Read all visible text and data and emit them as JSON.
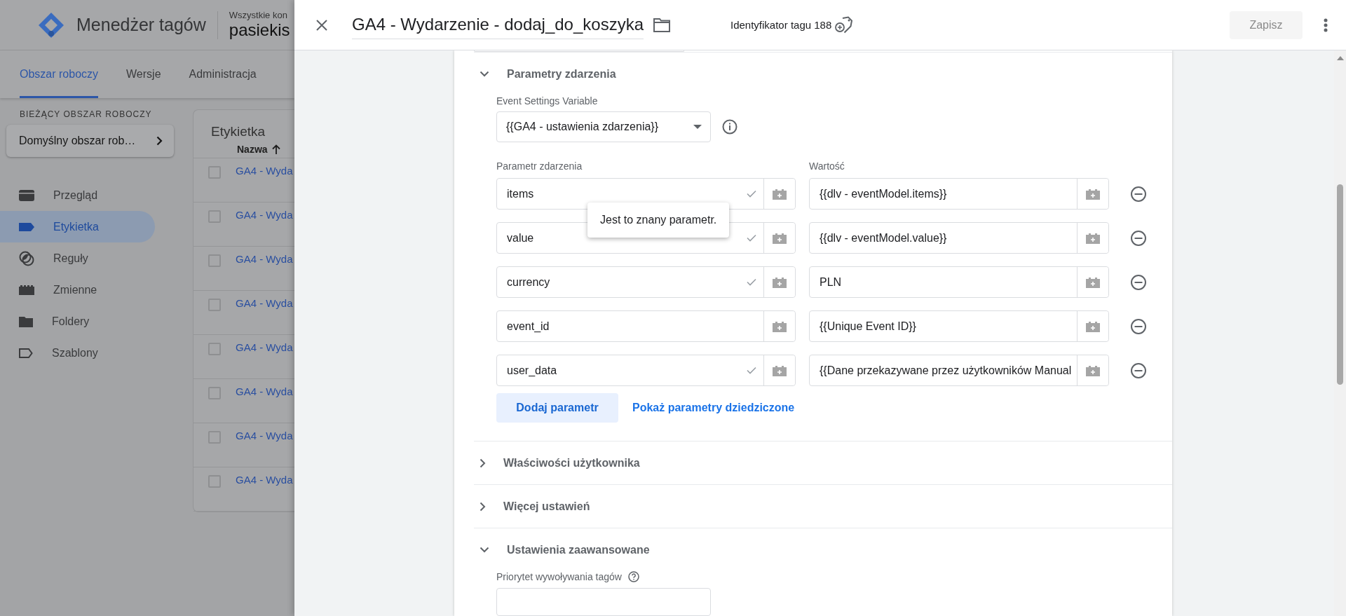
{
  "app": {
    "product": "Menedżer tagów",
    "account_label": "Wszystkie kon",
    "container": "pasiekis",
    "tabs": [
      {
        "label": "Obszar roboczy",
        "selected": true
      },
      {
        "label": "Wersje",
        "selected": false
      },
      {
        "label": "Administracja",
        "selected": false
      }
    ],
    "workspace": {
      "heading": "BIEŻĄCY OBSZAR ROBOCZY",
      "name": "Domyślny obszar rob…"
    },
    "nav": [
      {
        "kind": "overview",
        "label": "Przegląd",
        "selected": false
      },
      {
        "kind": "tags",
        "label": "Etykietka",
        "selected": true
      },
      {
        "kind": "triggers",
        "label": "Reguły",
        "selected": false
      },
      {
        "kind": "variables",
        "label": "Zmienne",
        "selected": false
      },
      {
        "kind": "folders",
        "label": "Foldery",
        "selected": false
      },
      {
        "kind": "templates",
        "label": "Szablony",
        "selected": false
      }
    ],
    "table": {
      "title": "Etykietka",
      "column": "Nazwa",
      "rows": [
        {
          "name": "GA4 - Wyda",
          "checked": false
        },
        {
          "name": "GA4 - Wyda",
          "checked": false
        },
        {
          "name": "GA4 - Wyda",
          "checked": false
        },
        {
          "name": "GA4 - Wyda",
          "checked": false
        },
        {
          "name": "GA4 - Wyda",
          "checked": false
        },
        {
          "name": "GA4 - Wyda",
          "checked": false
        },
        {
          "name": "GA4 - Wyda",
          "checked": false
        },
        {
          "name": "GA4 - Wyda",
          "checked": false
        }
      ]
    }
  },
  "panel": {
    "title": "GA4 - Wydarzenie - dodaj_do_koszyka",
    "tag_id": "Identyfikator tagu 188",
    "save_button": {
      "label": "Zapisz",
      "disabled": true
    },
    "sections": [
      {
        "kind": "event_parameters",
        "title": "Parametry zdarzenia",
        "expanded": true,
        "settings_variable": {
          "label": "Event Settings Variable",
          "value": "{{GA4 - ustawienia zdarzenia}}"
        },
        "columns": [
          "Parametr zdarzenia",
          "Wartość"
        ],
        "rows": [
          {
            "name": "items",
            "known": true,
            "value": "{{dlv - eventModel.items}}"
          },
          {
            "name": "value",
            "known": true,
            "value": "{{dlv - eventModel.value}}"
          },
          {
            "name": "currency",
            "known": true,
            "value": "PLN"
          },
          {
            "name": "event_id",
            "known": false,
            "value": "{{Unique Event ID}}"
          },
          {
            "name": "user_data",
            "known": true,
            "value": "{{Dane przekazywane przez użytkowników Manual"
          }
        ],
        "add_button": "Dodaj parametr",
        "inherited_link": "Pokaż parametry dziedziczone",
        "tooltip": "Jest to znany parametr."
      },
      {
        "title": "Właściwości użytkownika",
        "expanded": false
      },
      {
        "title": "Więcej ustawień",
        "expanded": false
      },
      {
        "kind": "advanced",
        "title": "Ustawienia zaawansowane",
        "expanded": true,
        "field_label": "Priorytet wywoływania tagów"
      }
    ]
  }
}
